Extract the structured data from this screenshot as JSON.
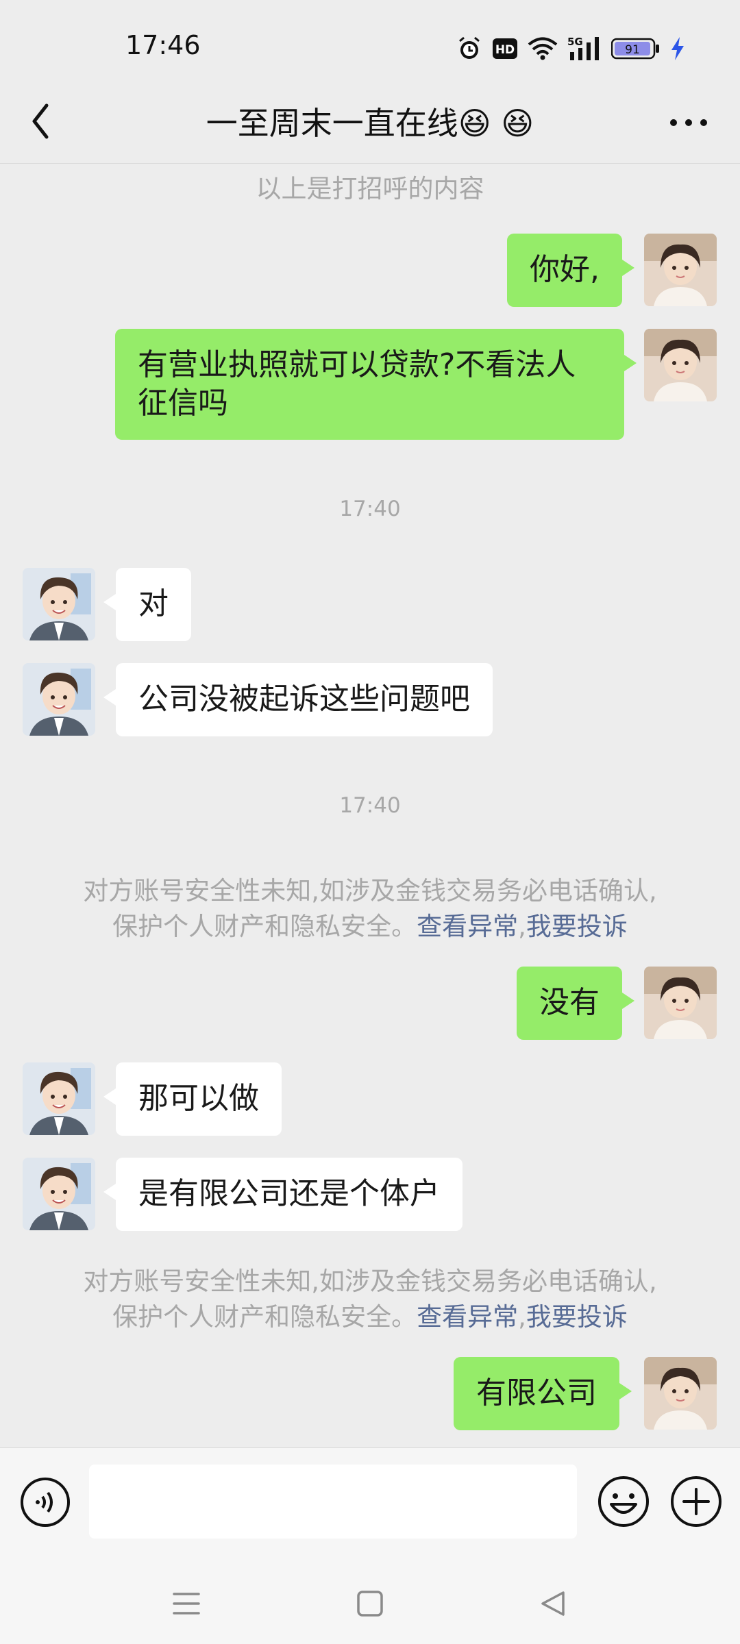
{
  "status_bar": {
    "time": "17:46",
    "battery": "91",
    "network": "5G",
    "hd": "HD"
  },
  "header": {
    "title": "一至周末一直在线😆 😆"
  },
  "chat": {
    "greeting_note": "以上是打招呼的内容",
    "messages": [
      {
        "dir": "out",
        "text": "你好,"
      },
      {
        "dir": "out",
        "text": "有营业执照就可以贷款?不看法人征信吗"
      },
      {
        "dir": "in",
        "text": "对"
      },
      {
        "dir": "in",
        "text": "公司没被起诉这些问题吧"
      },
      {
        "dir": "out",
        "text": "没有"
      },
      {
        "dir": "in",
        "text": "那可以做"
      },
      {
        "dir": "in",
        "text": "是有限公司还是个体户"
      },
      {
        "dir": "out",
        "text": "有限公司"
      }
    ],
    "timestamps": [
      "17:40",
      "17:40"
    ],
    "safety_notice": {
      "line1": "对方账号安全性未知,如涉及金钱交易务必电话确认,",
      "line2": "保护个人财产和隐私安全。",
      "link_view": "查看异常",
      "sep": ",",
      "link_report": "我要投诉"
    }
  },
  "input_bar": {
    "value": "",
    "placeholder": ""
  },
  "icons": {
    "back": "back-arrow-icon",
    "more": "more-dots-icon",
    "voice": "voice-icon",
    "emoji": "emoji-icon",
    "plus": "plus-icon",
    "nav_menu": "menu-icon",
    "nav_home": "home-icon",
    "nav_back": "back-triangle-icon"
  },
  "colors": {
    "outgoing_bubble": "#95ec69",
    "incoming_bubble": "#ffffff",
    "link": "#576b95",
    "background": "#ededed"
  }
}
